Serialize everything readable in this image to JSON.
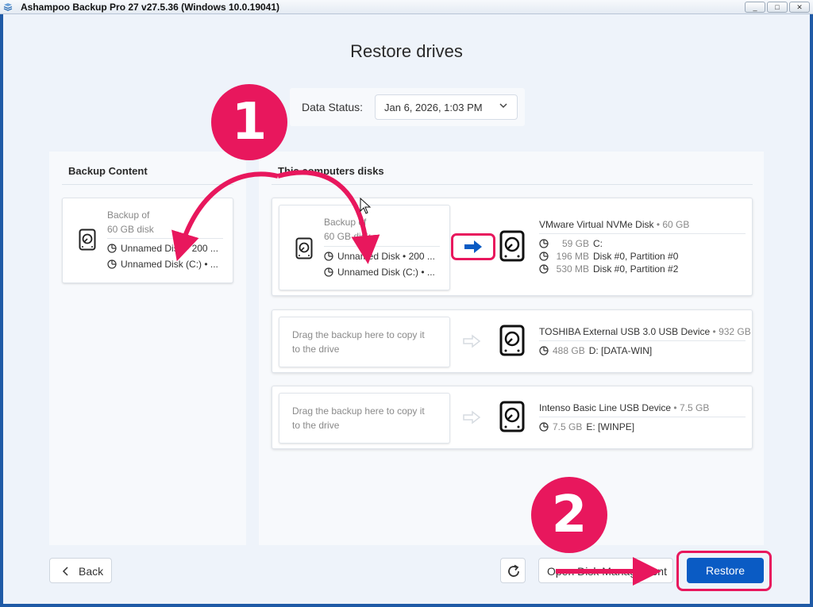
{
  "window": {
    "title": "Ashampoo Backup Pro 27 v27.5.36 (Windows 10.0.19041)",
    "controls": {
      "minimize": "_",
      "maximize": "□",
      "close": "✕"
    }
  },
  "page": {
    "title": "Restore drives"
  },
  "status": {
    "label": "Data Status:",
    "value": "Jan 6, 2026, 1:03 PM"
  },
  "backup_content": {
    "heading": "Backup Content",
    "card": {
      "line1": "Backup of",
      "line2": "60 GB disk",
      "partitions": [
        "Unnamed Disk • 200 ...",
        "Unnamed Disk (C:) • ..."
      ]
    }
  },
  "computer_disks": {
    "heading": "This computers disks",
    "drives": [
      {
        "name": "VMware Virtual NVMe Disk",
        "size": " • 60 GB",
        "partitions": [
          {
            "size": "59 GB",
            "label": "C:"
          },
          {
            "size": "196 MB",
            "label": "Disk #0, Partition #0"
          },
          {
            "size": "530 MB",
            "label": "Disk #0, Partition #2"
          }
        ]
      },
      {
        "name": "TOSHIBA External USB 3.0 USB Device",
        "size": " • 932 GB",
        "partitions": [
          {
            "size": "488 GB",
            "label": "D: [DATA-WIN]"
          }
        ]
      },
      {
        "name": "Intenso  Basic Line USB Device",
        "size": " • 7.5 GB",
        "partitions": [
          {
            "size": "7.5 GB",
            "label": "E: [WINPE]"
          }
        ]
      }
    ],
    "drag_hint_line1": "Drag the backup here to copy it",
    "drag_hint_line2": "to the drive"
  },
  "footer": {
    "back": "Back",
    "open_disk_management": "Open Disk Management",
    "restore": "Restore"
  },
  "annotations": {
    "step1": "1",
    "step2": "2",
    "accent_color": "#e8175d"
  }
}
